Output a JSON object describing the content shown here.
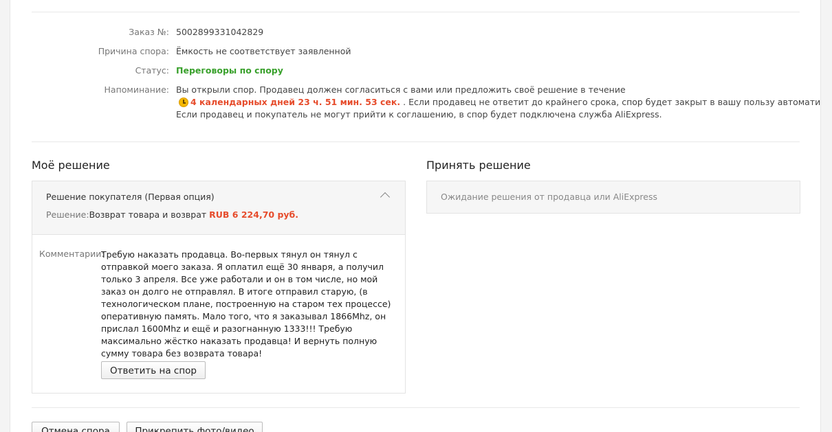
{
  "dispute": {
    "order_label": "Заказ №:",
    "order_number": "5002899331042829",
    "reason_label": "Причина спора:",
    "reason": "Ёмкость не соответствует заявленной",
    "status_label": "Статус:",
    "status": "Переговоры по спору",
    "reminder_label": "Напоминание:",
    "reminder_line1": "Вы открыли спор. Продавец должен согласиться с вами или предложить своё решение в течение",
    "timer": "4 календарных дней 23 ч. 51 мин. 53 сек.",
    "reminder_line2_rest": " . Если продавец не ответит до крайнего срока, спор будет закрыт в вашу пользу автоматически.",
    "reminder_line3": "Если продавец и покупатель не могут прийти к соглашению, в спор будет подключена служба AliExpress."
  },
  "my_solution": {
    "title": "Моё решение",
    "option_title": "Решение покупателя (Первая опция)",
    "solution_label": "Решение:",
    "solution_text": "Возврат товара и возврат ",
    "amount": "RUB 6 224,70 руб.",
    "comments_label": "Комментарии:",
    "comment": "Требую наказать продавца. Во-первых тянул он тянул с отправкой моего заказа. Я оплатил ещё 30 января, а получил только 3 апреля. Все уже работали и он в том числе, но мой заказ он долго не отправлял. В итоге отправил старую, (в технологическом плане, построенную на старом тех процессе) оперативную память. Мало того, что я заказывал 1866Mhz, он прислал 1600Mhz и ещё и разогнанную 1333!!! Требую максимально жёстко наказать продавца! И вернуть полную сумму товара без возврата товара!",
    "reply_button": "Ответить на спор"
  },
  "accept_solution": {
    "title": "Принять решение",
    "waiting_text": "Ожидание решения от продавца или AliExpress"
  },
  "footer": {
    "cancel_button": "Отмена спора",
    "attach_button": "Прикрепить фото/видео"
  },
  "colors": {
    "status_green": "#3aa12d",
    "accent_red": "#e64c2c"
  },
  "icons": {
    "timer": "clock-icon",
    "collapse": "chevron-up-icon"
  }
}
